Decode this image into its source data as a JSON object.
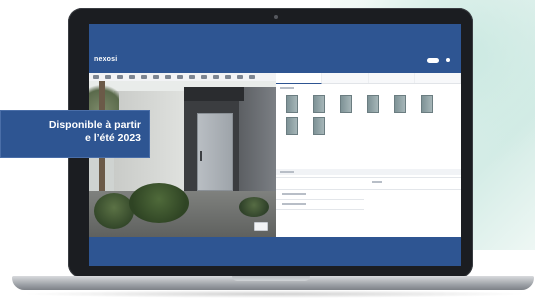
{
  "badge": {
    "line1": "Disponible à partir",
    "line2": "e l’été 2023"
  },
  "app": {
    "brand": "nexosi",
    "brand_sub": "",
    "colors": {
      "primary": "#2e5592",
      "panel": "#ffffff"
    }
  },
  "viewer": {
    "toolbar_icons": [
      "tool-icon",
      "tool-icon",
      "tool-icon",
      "tool-icon",
      "tool-icon",
      "tool-icon",
      "tool-icon",
      "tool-icon",
      "tool-icon",
      "tool-icon",
      "tool-icon",
      "tool-icon",
      "tool-icon",
      "tool-icon"
    ]
  },
  "panel": {
    "tab_count": 4,
    "door_model_count": 8
  }
}
